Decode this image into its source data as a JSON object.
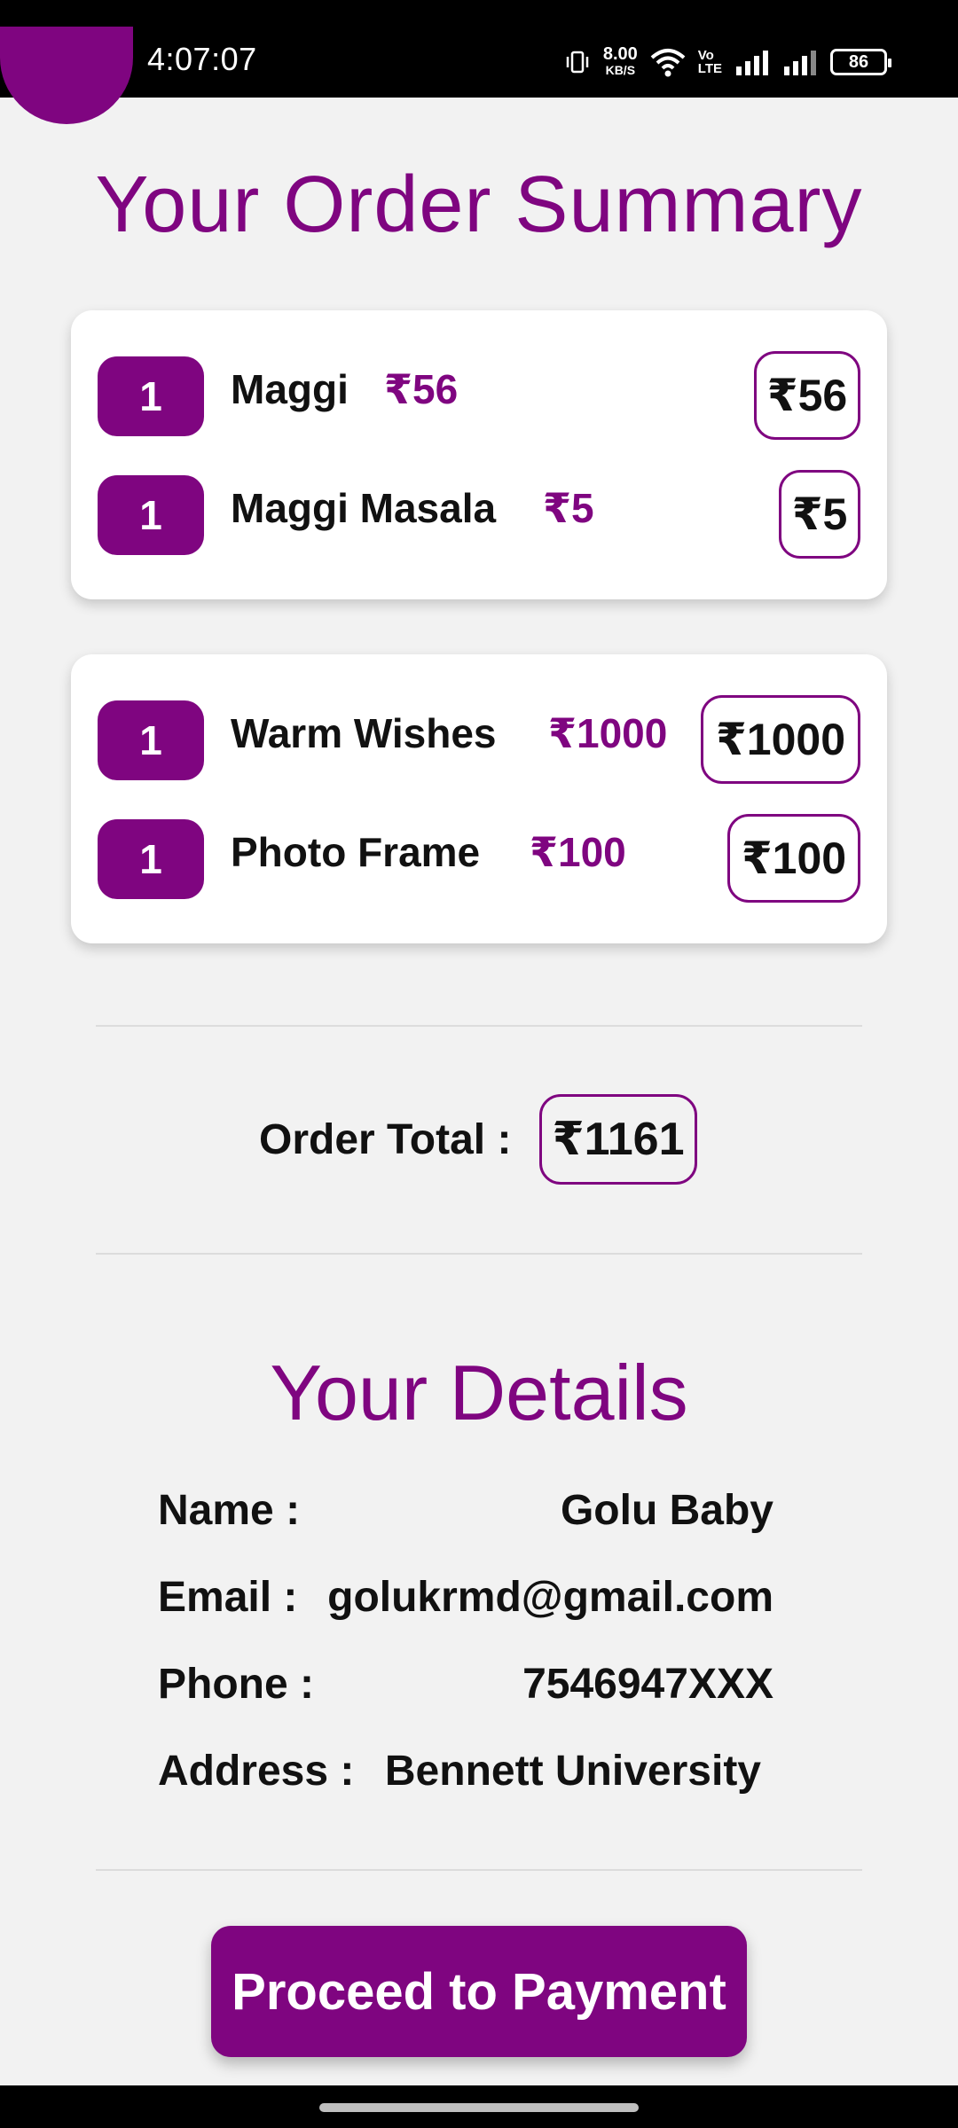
{
  "status": {
    "time": "4:07:07",
    "net_speed_value": "8.00",
    "net_speed_unit": "KB/S",
    "volte_top": "Vo",
    "volte_bottom": "LTE",
    "battery": "86"
  },
  "title": "Your Order Summary",
  "cart_groups": [
    {
      "items": [
        {
          "qty": "1",
          "name": "Maggi",
          "price": "₹56",
          "line_total": "₹56"
        },
        {
          "qty": "1",
          "name": "Maggi Masala",
          "price": "₹5",
          "line_total": "₹5"
        }
      ]
    },
    {
      "items": [
        {
          "qty": "1",
          "name": "Warm Wishes",
          "price": "₹1000",
          "line_total": "₹1000"
        },
        {
          "qty": "1",
          "name": "Photo Frame",
          "price": "₹100",
          "line_total": "₹100"
        }
      ]
    }
  ],
  "order_total": {
    "label": "Order Total :",
    "value": "₹1161"
  },
  "details": {
    "title": "Your Details",
    "name_label": "Name :",
    "name_value": "Golu Baby",
    "email_label": "Email :",
    "email_value": "golukrmd@gmail.com",
    "phone_label": "Phone :",
    "phone_value": "7546947XXX",
    "address_label": "Address :",
    "address_value": "Bennett University"
  },
  "proceed_button": "Proceed to Payment",
  "colors": {
    "accent": "#7f0580",
    "background": "#f2f2f2",
    "card": "#ffffff"
  }
}
